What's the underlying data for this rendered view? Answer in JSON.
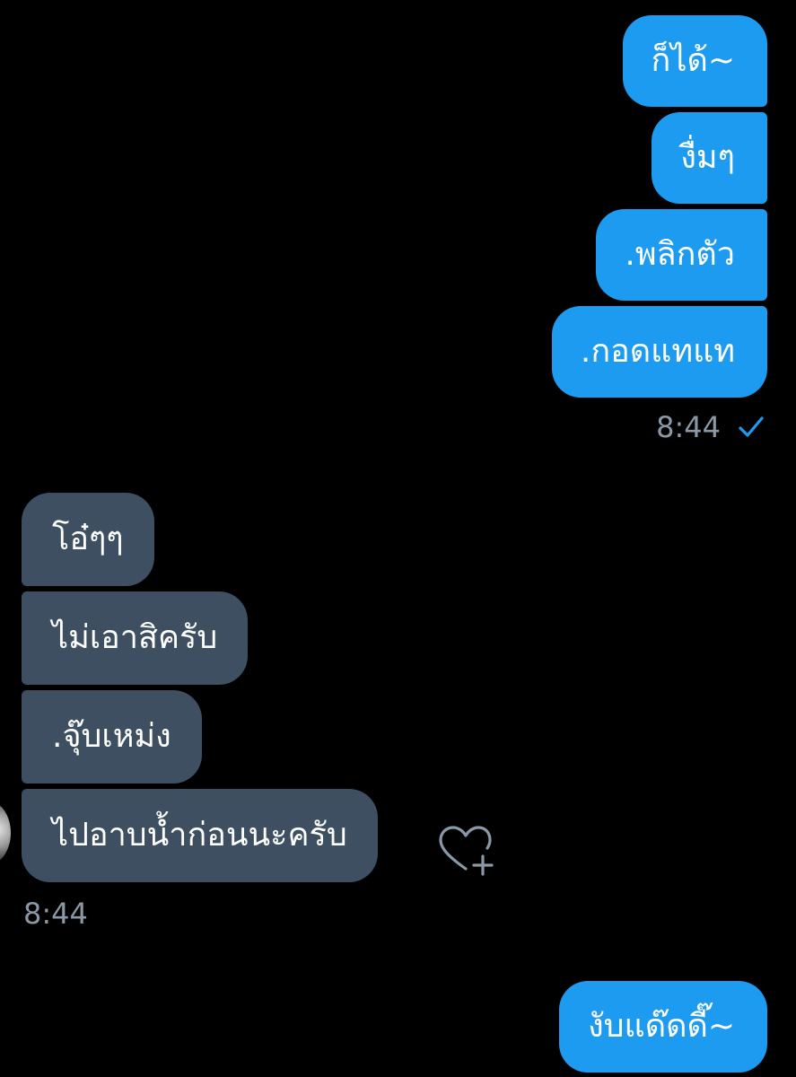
{
  "conversation": {
    "sent_top": [
      {
        "text": "ก็ได้~"
      },
      {
        "text": "งื่มๆ"
      },
      {
        "text": ".พลิกตัว"
      },
      {
        "text": ".กอดแทแท"
      }
    ],
    "sent_top_time": "8:44",
    "received": [
      {
        "text": "โอ๋ๆๆ"
      },
      {
        "text": "ไม่เอาสิครับ"
      },
      {
        "text": ".จุ๊บเหม่ง"
      },
      {
        "text": "ไปอาบน้ำก่อนนะครับ"
      }
    ],
    "received_time": "8:44",
    "sent_bottom": [
      {
        "text": "งับแด๊ดดี๊~"
      }
    ]
  },
  "icons": {
    "read_receipt": "checkmark-icon",
    "reaction": "heart-plus-icon"
  },
  "colors": {
    "background": "#000000",
    "sent_bubble": "#1d9bf0",
    "received_bubble": "#3d4f60",
    "meta_text": "#8b98a5"
  }
}
